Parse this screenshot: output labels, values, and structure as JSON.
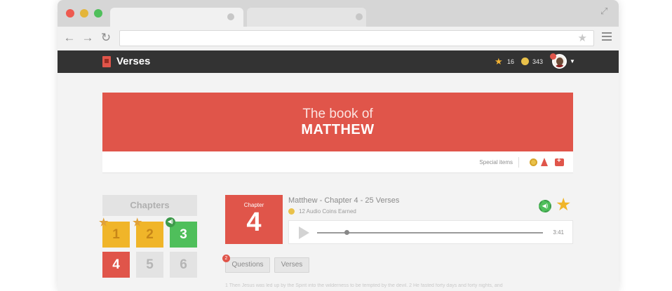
{
  "browser": {
    "url": ""
  },
  "app": {
    "title": "Verses",
    "stars": "16",
    "coins": "343"
  },
  "hero": {
    "subtitle": "The book of",
    "title": "MATTHEW"
  },
  "special": {
    "label": "Special items"
  },
  "chapters": {
    "heading": "Chapters",
    "tiles": [
      {
        "number": "1",
        "state": "gold",
        "star": true
      },
      {
        "number": "2",
        "state": "gold",
        "star": true
      },
      {
        "number": "3",
        "state": "green",
        "audio": true
      },
      {
        "number": "4",
        "state": "red"
      },
      {
        "number": "5",
        "state": "grey"
      },
      {
        "number": "6",
        "state": "grey"
      }
    ]
  },
  "chapter": {
    "badge_label": "Chapter",
    "badge_number": "4",
    "title": "Matthew - Chapter 4 - 25 Verses",
    "coins_text": "12 Audio Coins Earned",
    "duration": "3:41",
    "progress": 0.13
  },
  "tabs": {
    "questions": "Questions",
    "questions_count": "2",
    "verses": "Verses"
  },
  "body_text": "1 Then Jesus was led up by the Spirit into the wilderness to be tempted by the devil. 2 He fasted forty days and forty nights, and"
}
